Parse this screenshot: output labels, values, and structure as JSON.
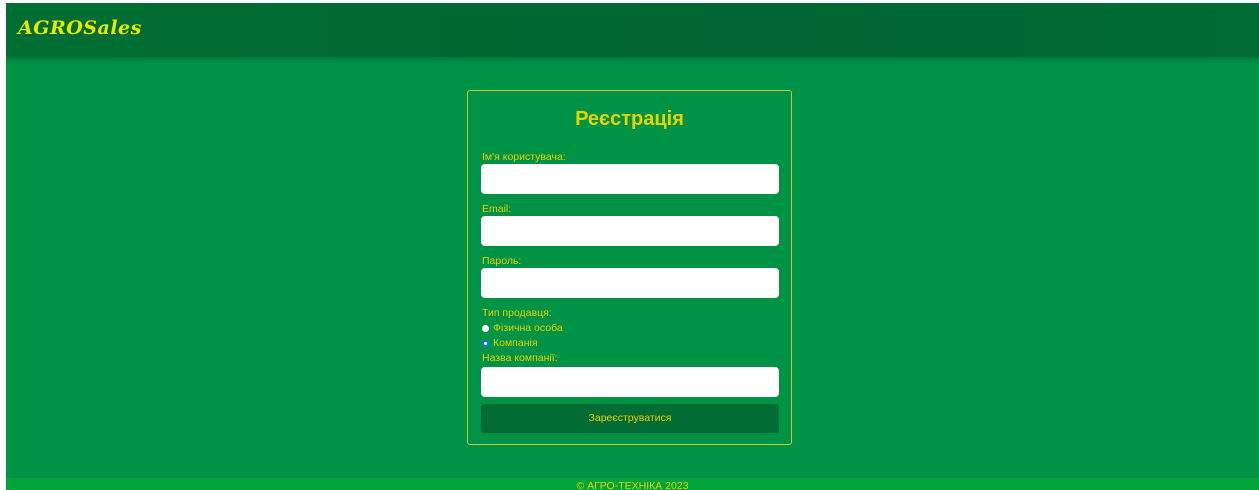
{
  "navbar": {
    "logo": "AGROSales"
  },
  "form": {
    "title": "Реєстрація",
    "username_label": "Ім'я користувача:",
    "username_value": "",
    "email_label": "Email:",
    "email_value": "",
    "password_label": "Пароль:",
    "password_value": "",
    "seller_type_label": "Тип продавця:",
    "seller_types": [
      {
        "label": "Фізична особа",
        "checked": false
      },
      {
        "label": "Компанія",
        "checked": true
      }
    ],
    "company_label": "Назва компанії:",
    "company_value": "",
    "submit_label": "Зареєструватися"
  },
  "footer": {
    "text": "© АГРО-ТЕХНІКА 2023"
  },
  "colors": {
    "background": "#009245",
    "navbar": "#006633",
    "accent_text": "#e6d400",
    "button": "#006b33",
    "footer": "#00a43a"
  }
}
